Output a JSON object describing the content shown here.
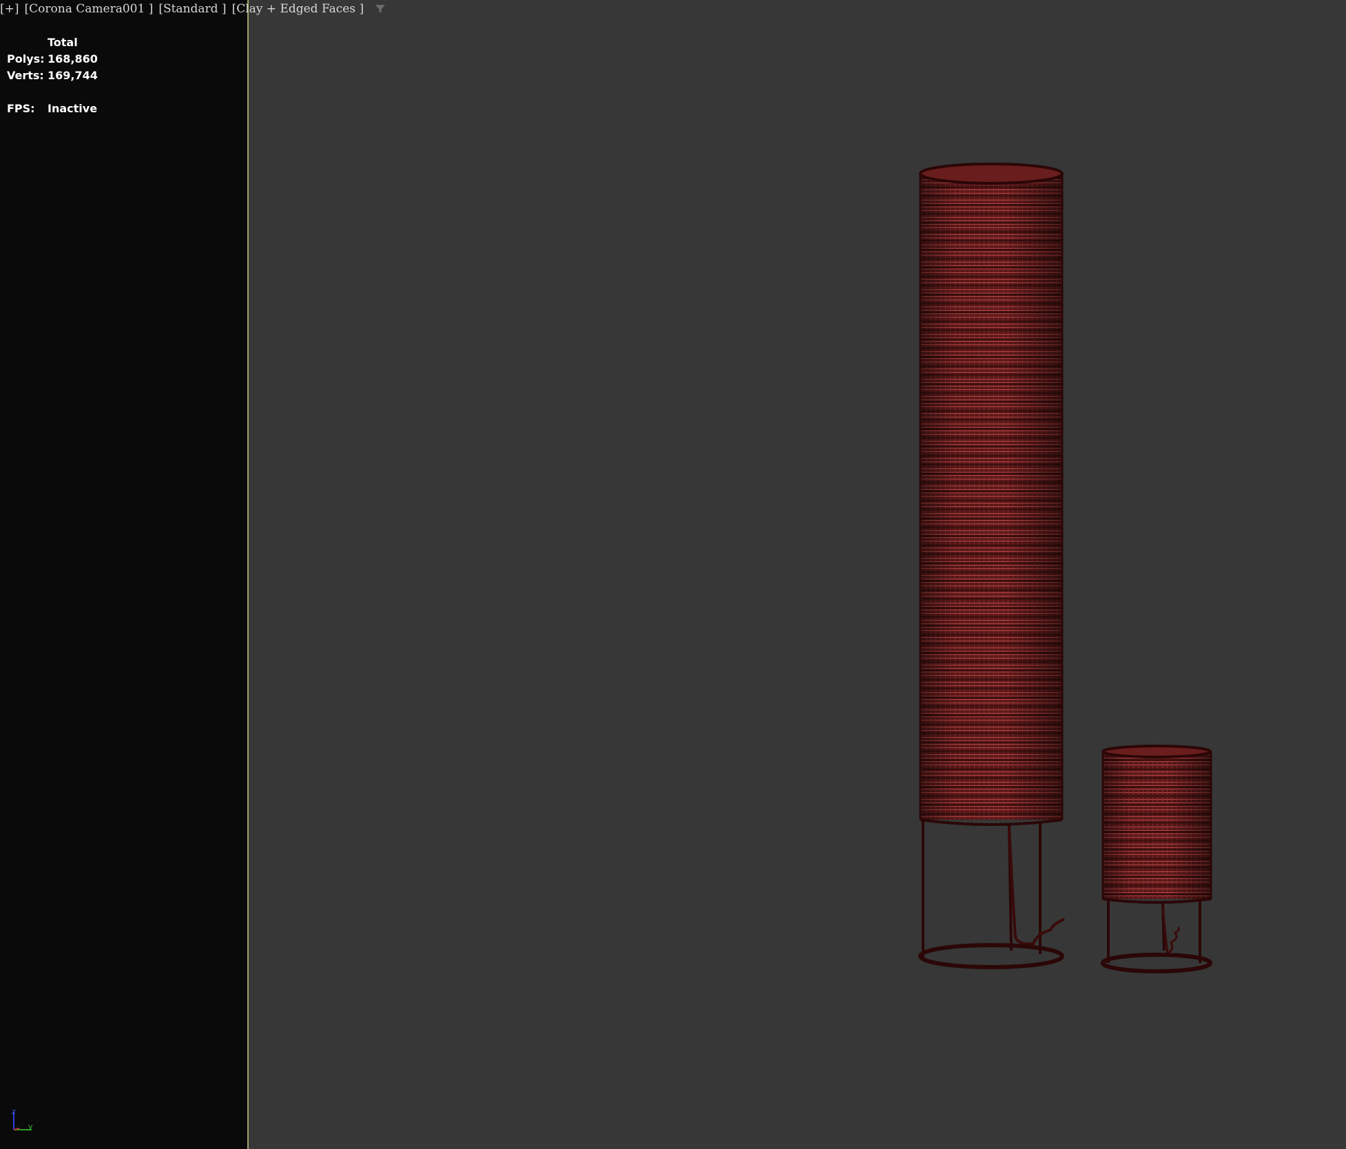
{
  "viewport": {
    "label_parts": [
      "[+]",
      "[Corona Camera001 ]",
      "[Standard ]",
      "[Clay + Edged Faces ]"
    ],
    "filter_icon": "funnel-filter-icon"
  },
  "stats": {
    "header": "Total",
    "polys_label": "Polys:",
    "polys_value": "168,860",
    "verts_label": "Verts:",
    "verts_value": "169,744",
    "fps_label": "FPS:",
    "fps_value": "Inactive"
  },
  "axis": {
    "z_label": "z",
    "y_label": "y",
    "icon": "axis-tripod-icon"
  },
  "scene": {
    "objects": [
      "tall-floor-lamp",
      "short-floor-lamp"
    ],
    "wire_color": "#8a2a2a",
    "frame_color": "#3a0c0c",
    "background": "#373737",
    "safe_frame_border": "#b7b46e"
  }
}
